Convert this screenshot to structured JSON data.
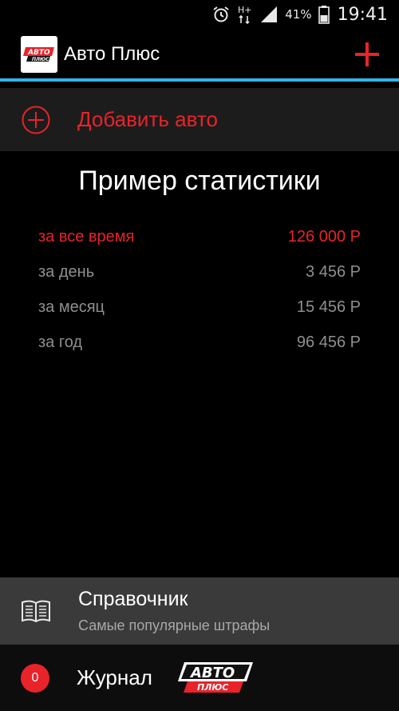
{
  "status_bar": {
    "battery": "41%",
    "time": "19:41",
    "network": "H+",
    "icons": [
      "alarm-icon",
      "network-icon",
      "signal-icon",
      "battery-icon"
    ]
  },
  "app_bar": {
    "title": "Авто Плюс",
    "logo_text_top": "АВТО",
    "logo_text_bottom": "ПЛЮС",
    "accent": "#33b5e5"
  },
  "add_car": {
    "label": "Добавить авто",
    "color": "#e8232a"
  },
  "stats": {
    "title": "Пример статистики",
    "rows": [
      {
        "label": "за все время",
        "value": "126 000 Р"
      },
      {
        "label": "за день",
        "value": "3 456 Р"
      },
      {
        "label": "за месяц",
        "value": "15 456 Р"
      },
      {
        "label": "за год",
        "value": "96 456 Р"
      }
    ]
  },
  "nav": {
    "reference_title": "Справочник",
    "reference_subtitle": "Самые популярные штрафы",
    "journal_title": "Журнал",
    "journal_badge": "0",
    "journal_logo_top": "АВТО",
    "journal_logo_bottom": "ПЛЮС"
  }
}
